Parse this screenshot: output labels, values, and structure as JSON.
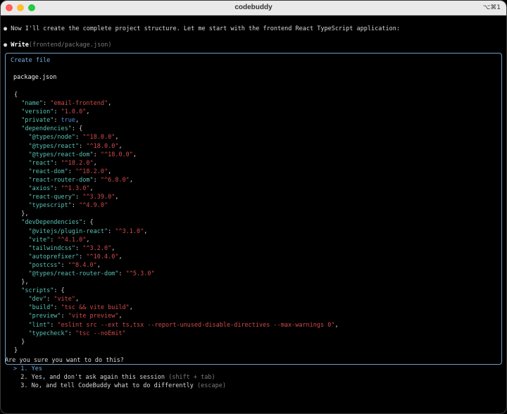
{
  "window": {
    "title": "codebuddy",
    "shortcut": "⌥⌘1"
  },
  "messages": {
    "intro": "Now I'll create the complete project structure. Let me start with the frontend React TypeScript application:",
    "tool_name": "Write",
    "tool_args": "(frontend/package.json)"
  },
  "panel": {
    "title": "Create file",
    "file_name": "package.json",
    "code": [
      [
        {
          "t": "{",
          "c": ""
        }
      ],
      [
        {
          "t": "  ",
          "c": ""
        },
        {
          "t": "\"name\"",
          "c": "k"
        },
        {
          "t": ": ",
          "c": ""
        },
        {
          "t": "\"email-frontend\"",
          "c": "s"
        },
        {
          "t": ",",
          "c": ""
        }
      ],
      [
        {
          "t": "  ",
          "c": ""
        },
        {
          "t": "\"version\"",
          "c": "k"
        },
        {
          "t": ": ",
          "c": ""
        },
        {
          "t": "\"1.0.0\"",
          "c": "s"
        },
        {
          "t": ",",
          "c": ""
        }
      ],
      [
        {
          "t": "  ",
          "c": ""
        },
        {
          "t": "\"private\"",
          "c": "k"
        },
        {
          "t": ": ",
          "c": ""
        },
        {
          "t": "true",
          "c": "b"
        },
        {
          "t": ",",
          "c": ""
        }
      ],
      [
        {
          "t": "  ",
          "c": ""
        },
        {
          "t": "\"dependencies\"",
          "c": "k"
        },
        {
          "t": ": {",
          "c": ""
        }
      ],
      [
        {
          "t": "    ",
          "c": ""
        },
        {
          "t": "\"@types/node\"",
          "c": "k"
        },
        {
          "t": ": ",
          "c": ""
        },
        {
          "t": "\"^18.0.0\"",
          "c": "s"
        },
        {
          "t": ",",
          "c": ""
        }
      ],
      [
        {
          "t": "    ",
          "c": ""
        },
        {
          "t": "\"@types/react\"",
          "c": "k"
        },
        {
          "t": ": ",
          "c": ""
        },
        {
          "t": "\"^18.0.0\"",
          "c": "s"
        },
        {
          "t": ",",
          "c": ""
        }
      ],
      [
        {
          "t": "    ",
          "c": ""
        },
        {
          "t": "\"@types/react-dom\"",
          "c": "k"
        },
        {
          "t": ": ",
          "c": ""
        },
        {
          "t": "\"^18.0.0\"",
          "c": "s"
        },
        {
          "t": ",",
          "c": ""
        }
      ],
      [
        {
          "t": "    ",
          "c": ""
        },
        {
          "t": "\"react\"",
          "c": "k"
        },
        {
          "t": ": ",
          "c": ""
        },
        {
          "t": "\"^18.2.0\"",
          "c": "s"
        },
        {
          "t": ",",
          "c": ""
        }
      ],
      [
        {
          "t": "    ",
          "c": ""
        },
        {
          "t": "\"react-dom\"",
          "c": "k"
        },
        {
          "t": ": ",
          "c": ""
        },
        {
          "t": "\"^18.2.0\"",
          "c": "s"
        },
        {
          "t": ",",
          "c": ""
        }
      ],
      [
        {
          "t": "    ",
          "c": ""
        },
        {
          "t": "\"react-router-dom\"",
          "c": "k"
        },
        {
          "t": ": ",
          "c": ""
        },
        {
          "t": "\"^6.8.0\"",
          "c": "s"
        },
        {
          "t": ",",
          "c": ""
        }
      ],
      [
        {
          "t": "    ",
          "c": ""
        },
        {
          "t": "\"axios\"",
          "c": "k"
        },
        {
          "t": ": ",
          "c": ""
        },
        {
          "t": "\"^1.3.0\"",
          "c": "s"
        },
        {
          "t": ",",
          "c": ""
        }
      ],
      [
        {
          "t": "    ",
          "c": ""
        },
        {
          "t": "\"react-query\"",
          "c": "k"
        },
        {
          "t": ": ",
          "c": ""
        },
        {
          "t": "\"^3.39.0\"",
          "c": "s"
        },
        {
          "t": ",",
          "c": ""
        }
      ],
      [
        {
          "t": "    ",
          "c": ""
        },
        {
          "t": "\"typescript\"",
          "c": "k"
        },
        {
          "t": ": ",
          "c": ""
        },
        {
          "t": "\"^4.9.0\"",
          "c": "s"
        }
      ],
      [
        {
          "t": "  },",
          "c": ""
        }
      ],
      [
        {
          "t": "  ",
          "c": ""
        },
        {
          "t": "\"devDependencies\"",
          "c": "k"
        },
        {
          "t": ": {",
          "c": ""
        }
      ],
      [
        {
          "t": "    ",
          "c": ""
        },
        {
          "t": "\"@vitejs/plugin-react\"",
          "c": "k"
        },
        {
          "t": ": ",
          "c": ""
        },
        {
          "t": "\"^3.1.0\"",
          "c": "s"
        },
        {
          "t": ",",
          "c": ""
        }
      ],
      [
        {
          "t": "    ",
          "c": ""
        },
        {
          "t": "\"vite\"",
          "c": "k"
        },
        {
          "t": ": ",
          "c": ""
        },
        {
          "t": "\"^4.1.0\"",
          "c": "s"
        },
        {
          "t": ",",
          "c": ""
        }
      ],
      [
        {
          "t": "    ",
          "c": ""
        },
        {
          "t": "\"tailwindcss\"",
          "c": "k"
        },
        {
          "t": ": ",
          "c": ""
        },
        {
          "t": "\"^3.2.0\"",
          "c": "s"
        },
        {
          "t": ",",
          "c": ""
        }
      ],
      [
        {
          "t": "    ",
          "c": ""
        },
        {
          "t": "\"autoprefixer\"",
          "c": "k"
        },
        {
          "t": ": ",
          "c": ""
        },
        {
          "t": "\"^10.4.0\"",
          "c": "s"
        },
        {
          "t": ",",
          "c": ""
        }
      ],
      [
        {
          "t": "    ",
          "c": ""
        },
        {
          "t": "\"postcss\"",
          "c": "k"
        },
        {
          "t": ": ",
          "c": ""
        },
        {
          "t": "\"^8.4.0\"",
          "c": "s"
        },
        {
          "t": ",",
          "c": ""
        }
      ],
      [
        {
          "t": "    ",
          "c": ""
        },
        {
          "t": "\"@types/react-router-dom\"",
          "c": "k"
        },
        {
          "t": ": ",
          "c": ""
        },
        {
          "t": "\"^5.3.0\"",
          "c": "s"
        }
      ],
      [
        {
          "t": "  },",
          "c": ""
        }
      ],
      [
        {
          "t": "  ",
          "c": ""
        },
        {
          "t": "\"scripts\"",
          "c": "k"
        },
        {
          "t": ": {",
          "c": ""
        }
      ],
      [
        {
          "t": "    ",
          "c": ""
        },
        {
          "t": "\"dev\"",
          "c": "k"
        },
        {
          "t": ": ",
          "c": ""
        },
        {
          "t": "\"vite\"",
          "c": "s"
        },
        {
          "t": ",",
          "c": ""
        }
      ],
      [
        {
          "t": "    ",
          "c": ""
        },
        {
          "t": "\"build\"",
          "c": "k"
        },
        {
          "t": ": ",
          "c": ""
        },
        {
          "t": "\"tsc && vite build\"",
          "c": "s"
        },
        {
          "t": ",",
          "c": ""
        }
      ],
      [
        {
          "t": "    ",
          "c": ""
        },
        {
          "t": "\"preview\"",
          "c": "k"
        },
        {
          "t": ": ",
          "c": ""
        },
        {
          "t": "\"vite preview\"",
          "c": "s"
        },
        {
          "t": ",",
          "c": ""
        }
      ],
      [
        {
          "t": "    ",
          "c": ""
        },
        {
          "t": "\"lint\"",
          "c": "k"
        },
        {
          "t": ": ",
          "c": ""
        },
        {
          "t": "\"eslint src --ext ts,tsx --report-unused-disable-directives --max-warnings 0\"",
          "c": "s"
        },
        {
          "t": ",",
          "c": ""
        }
      ],
      [
        {
          "t": "    ",
          "c": ""
        },
        {
          "t": "\"typecheck\"",
          "c": "k"
        },
        {
          "t": ": ",
          "c": ""
        },
        {
          "t": "\"tsc --noEmit\"",
          "c": "s"
        }
      ],
      [
        {
          "t": "  }",
          "c": ""
        }
      ],
      [
        {
          "t": "}",
          "c": ""
        }
      ]
    ]
  },
  "prompt": {
    "question": "Are you sure you want to do this?",
    "options": [
      {
        "marker": "> ",
        "label": "1. Yes",
        "hint": ""
      },
      {
        "marker": "  ",
        "label": "2. Yes, and don't ask again this session",
        "hint": "(shift + tab)"
      },
      {
        "marker": "  ",
        "label": "3. No, and tell CodeBuddy what to do differently",
        "hint": "(escape)"
      }
    ]
  },
  "colors": {
    "key": "#58c2b4",
    "string": "#d24a4a",
    "boolean": "#4f8bd6",
    "accent": "#6f9ec8",
    "selected": "#6fa8e0"
  }
}
